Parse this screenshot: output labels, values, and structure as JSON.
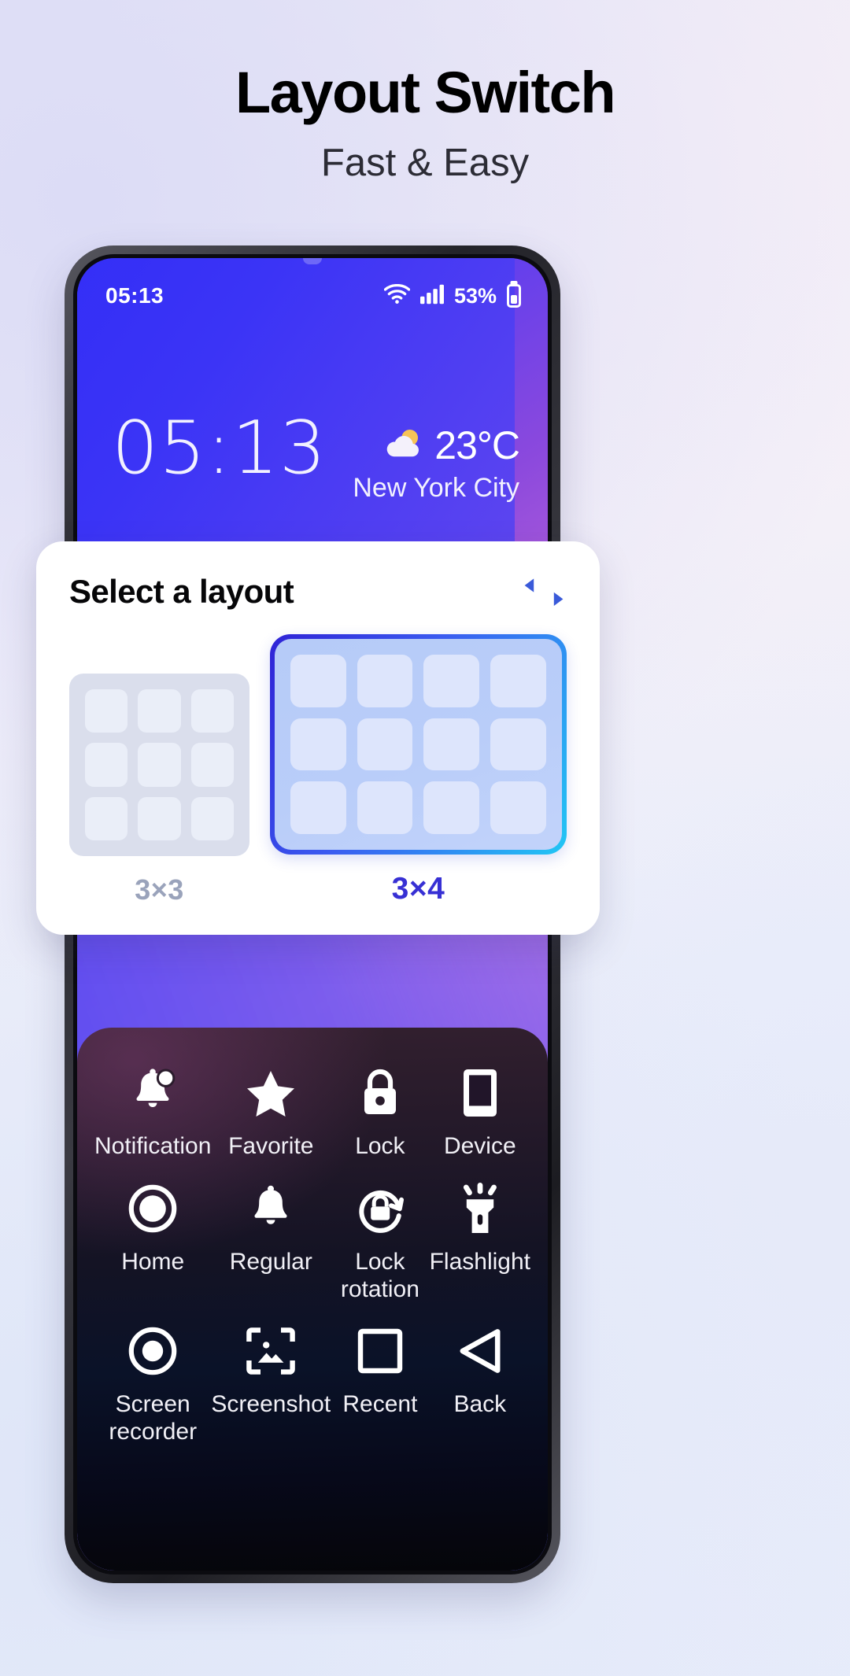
{
  "headline": {
    "title": "Layout Switch",
    "subtitle": "Fast & Easy"
  },
  "phone": {
    "status_bar": {
      "time": "05:13",
      "wifi_icon": "wifi-icon",
      "signal_icon": "cellular-signal-icon",
      "battery_percent": "53%",
      "battery_icon": "battery-icon"
    },
    "lockscreen": {
      "clock": "05:13",
      "weather_icon": "partly-cloudy-icon",
      "temperature": "23°C",
      "city": "New York City"
    },
    "control_panel": {
      "tiles": [
        {
          "label": "Notification",
          "icon": "bell-badge-icon"
        },
        {
          "label": "Favorite",
          "icon": "star-icon"
        },
        {
          "label": "Lock",
          "icon": "lock-icon"
        },
        {
          "label": "Device",
          "icon": "phone-device-icon"
        },
        {
          "label": "Home",
          "icon": "home-circle-icon"
        },
        {
          "label": "Regular",
          "icon": "bell-icon"
        },
        {
          "label": "Lock\nrotation",
          "icon": "lock-rotation-icon"
        },
        {
          "label": "Flashlight",
          "icon": "flashlight-icon"
        },
        {
          "label": "Screen\nrecorder",
          "icon": "record-icon"
        },
        {
          "label": "Screenshot",
          "icon": "screenshot-icon"
        },
        {
          "label": "Recent",
          "icon": "square-recent-icon"
        },
        {
          "label": "Back",
          "icon": "back-triangle-icon"
        }
      ]
    }
  },
  "dialog": {
    "title": "Select a layout",
    "swap_icon": "swap-arrows-icon",
    "accent_color": "#3730d4",
    "options": [
      {
        "label": "3×3",
        "columns": 3,
        "rows": 3,
        "selected": false
      },
      {
        "label": "3×4",
        "columns": 4,
        "rows": 3,
        "selected": true
      }
    ]
  }
}
